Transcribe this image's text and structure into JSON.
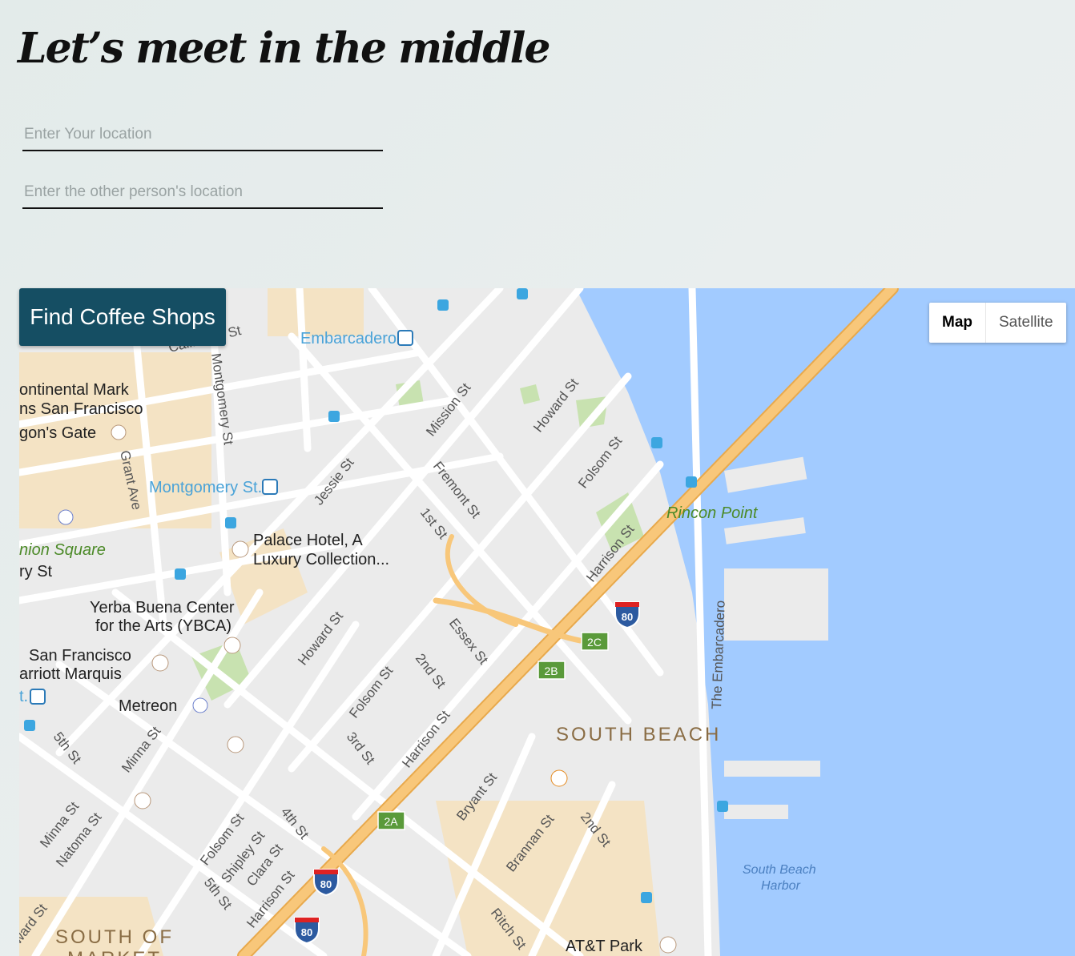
{
  "page": {
    "title": "Let’s meet in the middle"
  },
  "form": {
    "your_location_placeholder": "Enter Your location",
    "other_location_placeholder": "Enter the other person's location",
    "find_button": "Find Coffee Shops"
  },
  "map": {
    "type_control": {
      "map_label": "Map",
      "satellite_label": "Satellite",
      "selected": "Map"
    },
    "colors": {
      "water": "#a2cbff",
      "land": "#ebebeb",
      "road": "#ffffff",
      "highway": "#f8c77a",
      "urban": "#f4e3c4",
      "park": "#c8e2b0",
      "transit_label": "#4aa3d8",
      "park_label": "#4c8a28",
      "district_label": "#8a6d45"
    },
    "labels": {
      "embarcadero_station": "Embarcadero",
      "montgomery_station": "Montgomery St.",
      "intercontinental_1": "ontinental Mark",
      "intercontinental_2": "ns San Francisco",
      "dragons_gate": "gon's Gate",
      "union_square": "nion Square",
      "palace_hotel_1": "Palace Hotel, A",
      "palace_hotel_2": "Luxury Collection...",
      "ybca_1": "Yerba Buena Center",
      "ybca_2": "for the Arts (YBCA)",
      "marriott_1": "San Francisco",
      "marriott_2": "arriott Marquis",
      "metreon": "Metreon",
      "rincon_point": "Rincon Point",
      "south_beach": "SOUTH BEACH",
      "south_beach_harbor_1": "South Beach",
      "south_beach_harbor_2": "Harbor",
      "att_park": "AT&T Park",
      "south_of_market_1": "SOUTH OF",
      "south_of_market_2": "MARKET",
      "mission_st": "Mission St",
      "howard_st_north": "Howard St",
      "folsom_st_north": "Folsom St",
      "harrison_st_north": "Harrison St",
      "fremont_st": "Fremont St",
      "first_st": "1st St",
      "essex_st": "Essex St",
      "jessie_st": "Jessie St",
      "montgomery_st": "Montgomery St",
      "grant_ave": "Grant Ave",
      "california_st": "California St",
      "howard_st_south": "Howard St",
      "folsom_st_mid": "Folsom St",
      "second_st": "2nd St",
      "third_st": "3rd St",
      "harrison_st_mid": "Harrison St",
      "minna_st": "Minna St",
      "fifth_st": "5th St",
      "minna_st_2": "Minna St",
      "natoma_st": "Natoma St",
      "folsom_st_south": "Folsom St",
      "shipley_st": "Shipley St",
      "clara_st": "Clara St",
      "fourth_st": "4th St",
      "fifth_st_2": "5th St",
      "harrison_st_south": "Harrison St",
      "bryant_st": "Bryant St",
      "brannan_st": "Brannan St",
      "second_st_south": "2nd St",
      "ritch_st": "Ritch St",
      "embarcadero_st": "The Embarcadero",
      "ward_st": "ward St",
      "ry_st": "ry St",
      "station_t": "t."
    },
    "highway_shields": [
      "80",
      "80",
      "80"
    ],
    "exit_badges": [
      "2C",
      "2B",
      "2A"
    ]
  }
}
